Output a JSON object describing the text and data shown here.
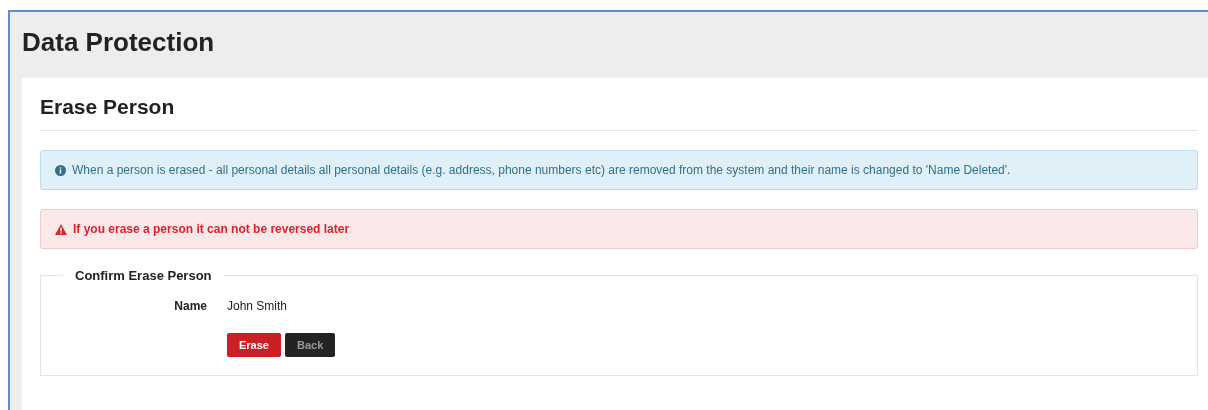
{
  "page_title": "Data Protection",
  "panel": {
    "title": "Erase Person"
  },
  "alerts": [
    {
      "kind": "info",
      "text": "When a person is erased - all personal details all personal details (e.g. address, phone numbers etc) are removed from the system and their name is changed to 'Name Deleted'."
    },
    {
      "kind": "danger",
      "text": "If you erase a person it can not be reversed later"
    }
  ],
  "form": {
    "legend": "Confirm Erase Person",
    "fields": [
      {
        "label": "Name",
        "value": "John Smith"
      }
    ],
    "buttons": [
      {
        "kind": "danger",
        "label": "Erase"
      },
      {
        "kind": "dark",
        "label": "Back"
      }
    ]
  }
}
